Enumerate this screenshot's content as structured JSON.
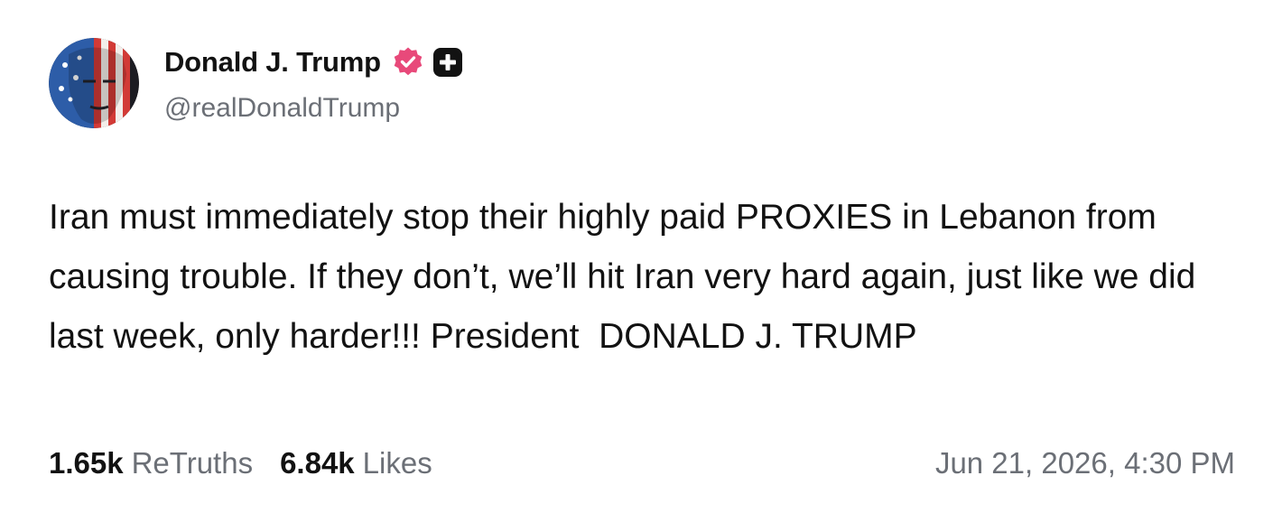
{
  "author": {
    "display_name": "Donald J. Trump",
    "handle": "@realDonaldTrump",
    "verified_icon": "verified-badge-icon",
    "plus_icon": "plus-badge-icon",
    "verified_color": "#e8497a"
  },
  "post": {
    "text": "Iran must immediately stop their highly paid PROXIES in Lebanon from causing trouble. If they don’t, we’ll hit Iran very hard again, just like we did last week, only harder!!! President  DONALD J. TRUMP"
  },
  "stats": {
    "retruths_count": "1.65k",
    "retruths_label": "ReTruths",
    "likes_count": "6.84k",
    "likes_label": "Likes"
  },
  "timestamp": "Jun 21, 2026, 4:30 PM"
}
